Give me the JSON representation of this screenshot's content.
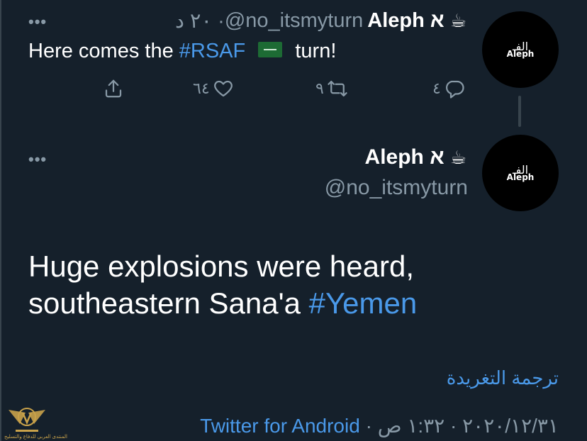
{
  "colors": {
    "background": "#15202b",
    "accent": "#4a99e9",
    "muted": "#8899a6",
    "divider": "#38444d"
  },
  "tweet1": {
    "author_name": "Aleph א",
    "author_emoji": "☕",
    "handle": "@no_itsmyturn",
    "time": "٢٠ د",
    "separator": "·",
    "text_before": "Here comes the",
    "hashtag": "#RSAF",
    "text_after": "turn!",
    "avatar_ar": "الفـ",
    "avatar_en": "Aleph",
    "replies": "٤",
    "retweets": "٩",
    "likes": "٦٤",
    "icons": [
      "share-icon",
      "like-icon",
      "retweet-icon",
      "reply-icon"
    ]
  },
  "tweet2": {
    "author_name": "Aleph א",
    "author_emoji": "☕",
    "handle": "@no_itsmyturn",
    "avatar_ar": "الفـ",
    "avatar_en": "Aleph",
    "body_line1": "Huge explosions were heard,",
    "body_line2_text": "southeastern Sana'a",
    "body_hashtag": "#Yemen",
    "translate_label": "ترجمة التغريدة",
    "datetime": "٢٠٢٠/١٢/٣١ · ١:٣٢ ص",
    "separator": "·",
    "source": "Twitter for Android"
  },
  "more_label": "•••",
  "watermark_text": "المنتدى العربي للدفاع والتسليح"
}
